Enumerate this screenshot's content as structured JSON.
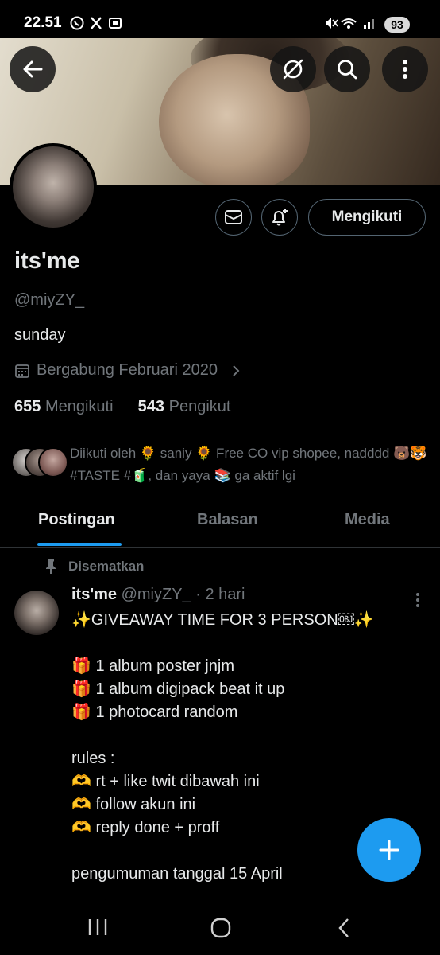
{
  "status_bar": {
    "time": "22.51",
    "left_icons": "whatsapp-icon x-icon screenshot-icon",
    "battery": "93"
  },
  "header": {
    "icons": [
      "back-arrow-icon",
      "grok-icon",
      "search-icon",
      "more-vertical-icon"
    ]
  },
  "profile": {
    "follow_button": "Mengikuti",
    "name": "its'me",
    "handle": "@miyZY_",
    "bio": "sunday",
    "joined": "Bergabung Februari 2020",
    "following_count": "655",
    "following_label": "Mengikuti",
    "followers_count": "543",
    "followers_label": "Pengikut",
    "followed_by": "Diikuti oleh 🌻 saniy 🌻 Free CO vip shopee, nadddd 🐻🐯 #TASTE #🧃, dan yaya 📚 ga aktif lgi"
  },
  "tabs": [
    "Postingan",
    "Balasan",
    "Media"
  ],
  "pinned_post": {
    "pinned_label": "Disematkan",
    "author": "its'me",
    "handle": "@miyZY_",
    "time": "· 2 hari",
    "text": "✨GIVEAWAY TIME FOR 3 PERSON￼✨\n\n🎁 1 album poster jnjm\n🎁 1 album digipack beat it up\n🎁 1 photocard random\n\nrules :\n🫶 rt + like twit dibawah ini\n🫶 follow akun ini\n🫶 reply done + proff\n\npengumuman tanggal 15 April"
  },
  "colors": {
    "accent": "#1d9bf0",
    "background": "#000000",
    "secondary_text": "#71767b"
  }
}
